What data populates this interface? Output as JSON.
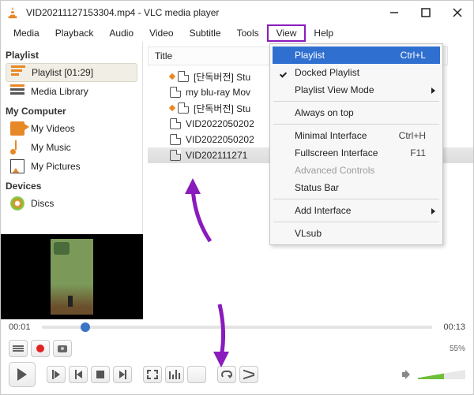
{
  "window": {
    "title": "VID20211127153304.mp4 - VLC media player"
  },
  "menubar": {
    "items": [
      "Media",
      "Playback",
      "Audio",
      "Video",
      "Subtitle",
      "Tools",
      "View",
      "Help"
    ],
    "highlighted_index": 6
  },
  "sidebar": {
    "sections": [
      {
        "label": "Playlist",
        "items": [
          {
            "icon": "playlist",
            "label": "Playlist [01:29]",
            "selected": true
          },
          {
            "icon": "mlib",
            "label": "Media Library"
          }
        ]
      },
      {
        "label": "My Computer",
        "items": [
          {
            "icon": "video",
            "label": "My Videos"
          },
          {
            "icon": "music",
            "label": "My Music"
          },
          {
            "icon": "pics",
            "label": "My Pictures"
          }
        ]
      },
      {
        "label": "Devices",
        "items": [
          {
            "icon": "disc",
            "label": "Discs"
          }
        ]
      }
    ]
  },
  "playlist": {
    "column_header": "Title",
    "rows": [
      {
        "title": "[단독버전] Stu",
        "marker": true
      },
      {
        "title": "my blu-ray Mov",
        "marker": false
      },
      {
        "title": "[단독버전] Stu",
        "marker": true
      },
      {
        "title": "VID2022050202",
        "marker": false
      },
      {
        "title": "VID2022050202",
        "marker": false
      },
      {
        "title": "VID202111271",
        "marker": false,
        "selected": true
      }
    ]
  },
  "view_menu": {
    "items": [
      {
        "label": "Playlist",
        "accel": "Ctrl+L",
        "selected": true
      },
      {
        "label": "Docked Playlist",
        "checked": true
      },
      {
        "label": "Playlist View Mode",
        "submenu": true
      },
      {
        "separator": true
      },
      {
        "label": "Always on top"
      },
      {
        "separator": true
      },
      {
        "label": "Minimal Interface",
        "accel": "Ctrl+H"
      },
      {
        "label": "Fullscreen Interface",
        "accel": "F11"
      },
      {
        "label": "Advanced Controls",
        "disabled": true
      },
      {
        "label": "Status Bar"
      },
      {
        "separator": true
      },
      {
        "label": "Add Interface",
        "submenu": true
      },
      {
        "separator": true
      },
      {
        "label": "VLsub"
      }
    ]
  },
  "seek": {
    "current": "00:01",
    "duration": "00:13"
  },
  "volume": {
    "percent_label": "55%"
  }
}
